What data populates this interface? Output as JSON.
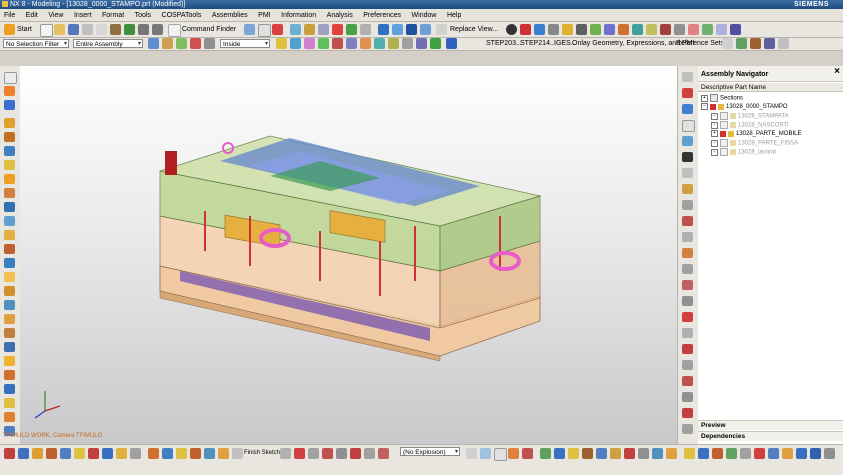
{
  "window": {
    "title": "NX 8 - Modeling - [13028_0000_STAMPO.prt (Modified)]",
    "brand": "SIEMENS"
  },
  "menu": [
    "File",
    "Edit",
    "View",
    "Insert",
    "Format",
    "Tools",
    "COSPATools",
    "Assemblies",
    "PMI",
    "Information",
    "Analysis",
    "Preferences",
    "Window",
    "Help"
  ],
  "toolbar": {
    "start": "Start",
    "command_finder": "Command Finder",
    "replace_view": "Replace View...",
    "step203": "STEP203...",
    "step214": "STEP214...",
    "iges": "IGES...",
    "overlay": "Onlay Geometry, Expressions, and PMI",
    "reference_sets": "Reference Sets...",
    "selection_filter": "No Selection Filter",
    "assembly_scope": "Entire Assembly",
    "inside": "Inside"
  },
  "navigator": {
    "title": "Assembly Navigator",
    "column": "Descriptive Part Name",
    "items": [
      {
        "label": "Sections",
        "level": 0,
        "dim": false
      },
      {
        "label": "13028_0000_STAMPO",
        "level": 0,
        "dim": false
      },
      {
        "label": "13028_STAMPATA",
        "level": 1,
        "dim": true
      },
      {
        "label": "13028_NASCOSTI",
        "level": 1,
        "dim": true
      },
      {
        "label": "13028_PARTE_MOBILE",
        "level": 1,
        "dim": false
      },
      {
        "label": "13028_PARTE_FISSA",
        "level": 1,
        "dim": true
      },
      {
        "label": "13028_lavorat",
        "level": 1,
        "dim": true
      }
    ],
    "preview": "Preview",
    "dependencies": "Dependencies"
  },
  "status_text": "TFIMULO WORK: Camera TFIMULO",
  "bottom": {
    "sketch": "Finish Sketch",
    "explosion": "(No Explosion)"
  },
  "colors": {
    "accent": "#3a6ea5",
    "mold_base": "#f2c9a0",
    "mold_green": "#b9d48a",
    "eyebolt": "#e85cc8"
  }
}
